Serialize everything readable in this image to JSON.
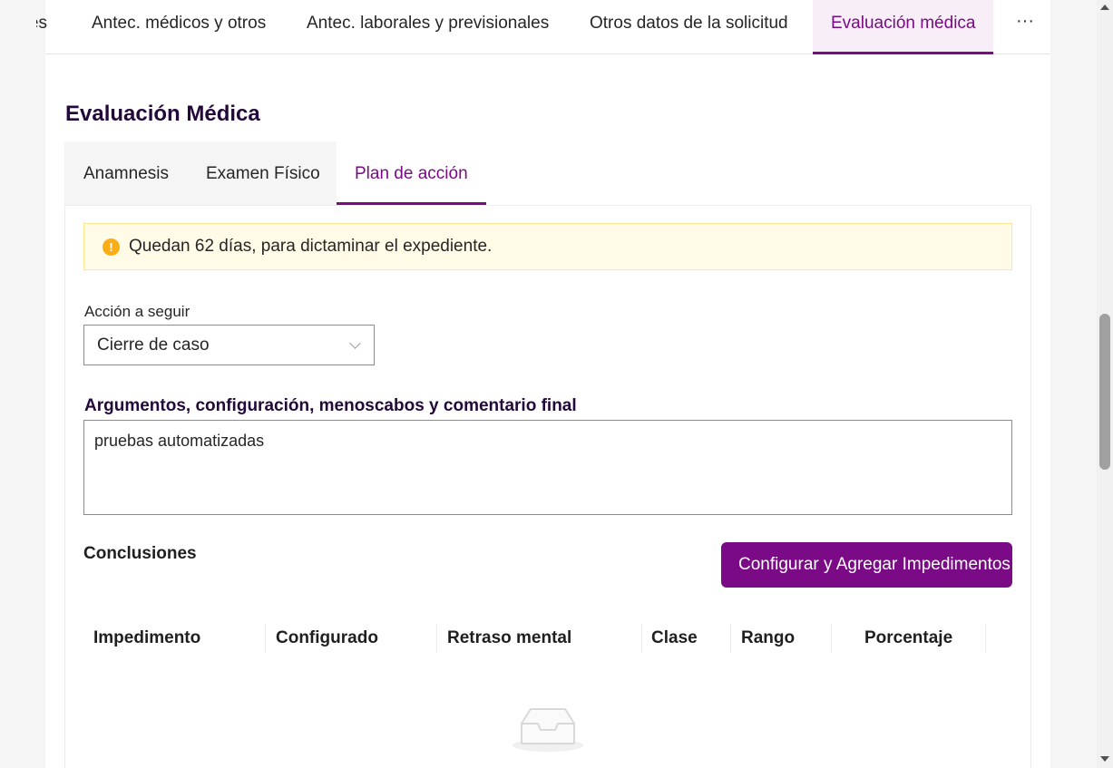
{
  "top_tabs": {
    "clipped_label": "es",
    "items": [
      {
        "label": "Antec. médicos y otros"
      },
      {
        "label": "Antec. laborales y previsionales"
      },
      {
        "label": "Otros datos de la solicitud"
      },
      {
        "label": "Evaluación médica",
        "active": true
      }
    ],
    "more_label": "···"
  },
  "page": {
    "title": "Evaluación Médica"
  },
  "sub_tabs": [
    {
      "label": "Anamnesis"
    },
    {
      "label": "Examen Físico"
    },
    {
      "label": "Plan de acción",
      "active": true
    }
  ],
  "alert": {
    "icon": "exclamation-circle-icon",
    "icon_glyph": "!",
    "text": "Quedan 62 días, para dictaminar el expediente.",
    "color": "#faad14"
  },
  "action": {
    "label": "Acción a seguir",
    "value": "Cierre de caso"
  },
  "arguments": {
    "label": "Argumentos, configuración, menoscabos y comentario final",
    "value": "pruebas automatizadas"
  },
  "conclusions": {
    "title": "Conclusiones",
    "button_label": "Configurar y Agregar Impedimentos",
    "columns": [
      "Impedimento",
      "Configurado",
      "Retraso mental",
      "Clase",
      "Rango",
      "Porcentaje"
    ],
    "rows": []
  },
  "colors": {
    "accent": "#7a0a85",
    "alert_bg": "#fffbe6",
    "alert_border": "#ffe58f"
  }
}
